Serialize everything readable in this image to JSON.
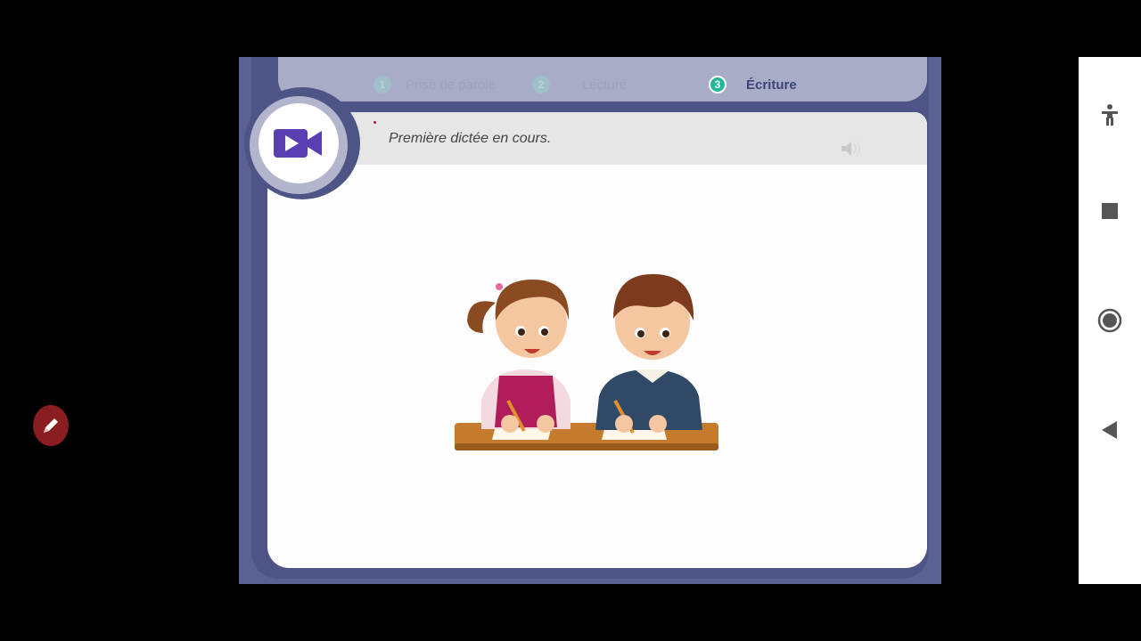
{
  "steps": [
    {
      "number": "1",
      "label": "Prise de parole",
      "state": "inactive"
    },
    {
      "number": "2",
      "label": "Lecture",
      "state": "inactive"
    },
    {
      "number": "3",
      "label": "Écriture",
      "state": "active"
    }
  ],
  "instruction": {
    "text": "Première dictée en cours."
  },
  "icons": {
    "video": "video-camera-icon",
    "speaker": "speaker-icon",
    "accessibility": "accessibility-icon",
    "recents": "square-stop-icon",
    "home": "circle-home-icon",
    "back": "triangle-back-icon",
    "pen": "pen-icon"
  },
  "colors": {
    "frame": "#5b6191",
    "accent_step": "#1fb89a",
    "video_icon": "#5a3fb3",
    "pen_button": "#8a1d1f"
  }
}
